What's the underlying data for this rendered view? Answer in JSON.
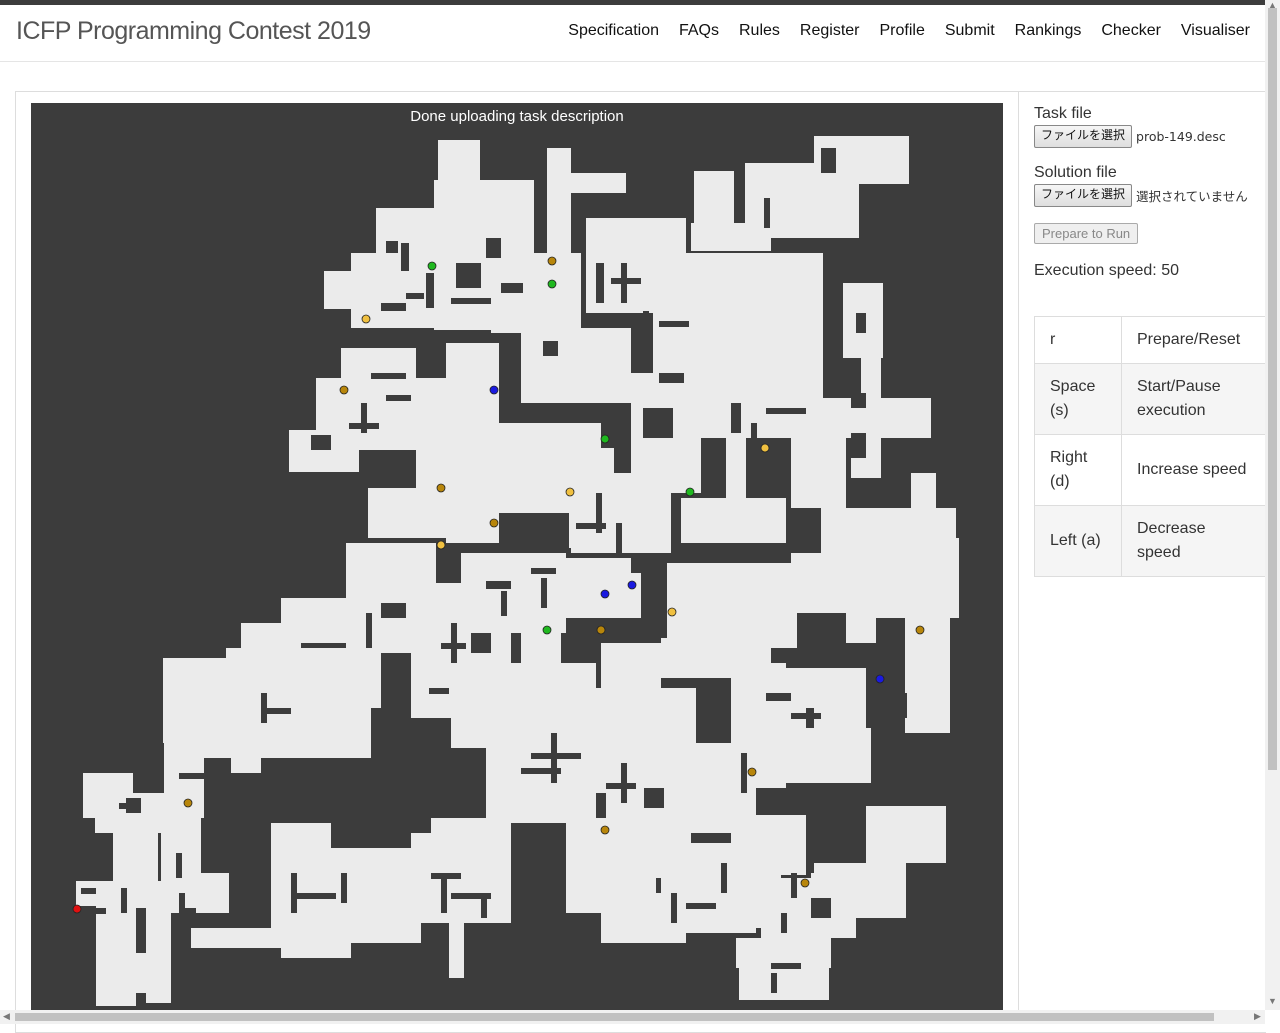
{
  "header": {
    "title": "ICFP Programming Contest 2019",
    "nav": [
      "Specification",
      "FAQs",
      "Rules",
      "Register",
      "Profile",
      "Submit",
      "Rankings",
      "Checker",
      "Visualiser"
    ]
  },
  "canvas": {
    "status": "Done uploading task description",
    "colors": {
      "wall": "#3c3c3c",
      "floor": "#ebebeb",
      "booster_b": "#b8860b",
      "booster_f": "#1fb81f",
      "booster_l": "#f0c040",
      "booster_x": "#1a1ae0",
      "worker": "#e01010"
    }
  },
  "side": {
    "task_label": "Task file",
    "task_button": "ファイルを選択",
    "task_file": "prob-149.desc",
    "solution_label": "Solution file",
    "solution_button": "ファイルを選択",
    "solution_file": "選択されていません",
    "prepare_button": "Prepare to Run",
    "speed_text": "Execution speed: 50"
  },
  "keys": [
    {
      "key": "r",
      "action": "Prepare/Reset"
    },
    {
      "key": "Space (s)",
      "action": "Start/Pause execution"
    },
    {
      "key": "Right (d)",
      "action": "Increase speed"
    },
    {
      "key": "Left (a)",
      "action": "Decrease speed"
    }
  ]
}
